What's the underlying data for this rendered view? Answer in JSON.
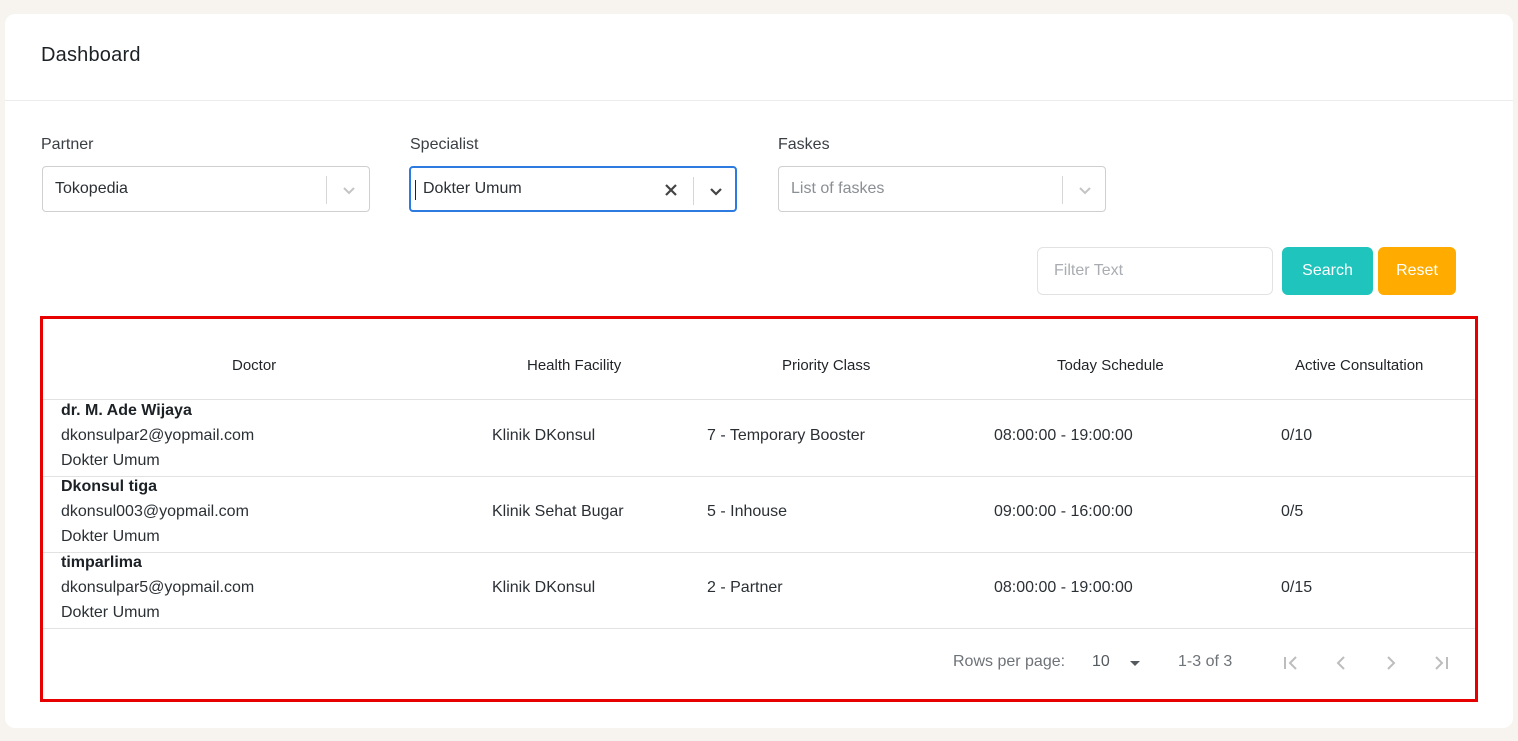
{
  "header": {
    "title": "Dashboard"
  },
  "filters": {
    "partner": {
      "label": "Partner",
      "value": "Tokopedia"
    },
    "specialist": {
      "label": "Specialist",
      "value": "Dokter Umum"
    },
    "faskes": {
      "label": "Faskes",
      "placeholder": "List of faskes"
    }
  },
  "search": {
    "placeholder": "Filter Text",
    "search_label": "Search",
    "reset_label": "Reset"
  },
  "table": {
    "columns": [
      "Doctor",
      "Health Facility",
      "Priority Class",
      "Today Schedule",
      "Active Consultation"
    ],
    "rows": [
      {
        "name": "dr. M. Ade Wijaya",
        "email": "dkonsulpar2@yopmail.com",
        "specialist": "Dokter Umum",
        "facility": "Klinik DKonsul",
        "priority": "7 - Temporary Booster",
        "schedule": "08:00:00 - 19:00:00",
        "active": "0/10"
      },
      {
        "name": "Dkonsul tiga",
        "email": "dkonsul003@yopmail.com",
        "specialist": "Dokter Umum",
        "facility": "Klinik Sehat Bugar",
        "priority": "5 - Inhouse",
        "schedule": "09:00:00 - 16:00:00",
        "active": "0/5"
      },
      {
        "name": "timparlima",
        "email": "dkonsulpar5@yopmail.com",
        "specialist": "Dokter Umum",
        "facility": "Klinik DKonsul",
        "priority": "2 - Partner",
        "schedule": "08:00:00 - 19:00:00",
        "active": "0/15"
      }
    ],
    "footer": {
      "rows_per_page_label": "Rows per page:",
      "rows_per_page_value": "10",
      "range": "1-3 of 3"
    }
  },
  "colors": {
    "search_button": "#1fc4bd",
    "reset_button": "#ffab00",
    "focus_border": "#2d7be0",
    "highlight_border": "#e60000"
  }
}
